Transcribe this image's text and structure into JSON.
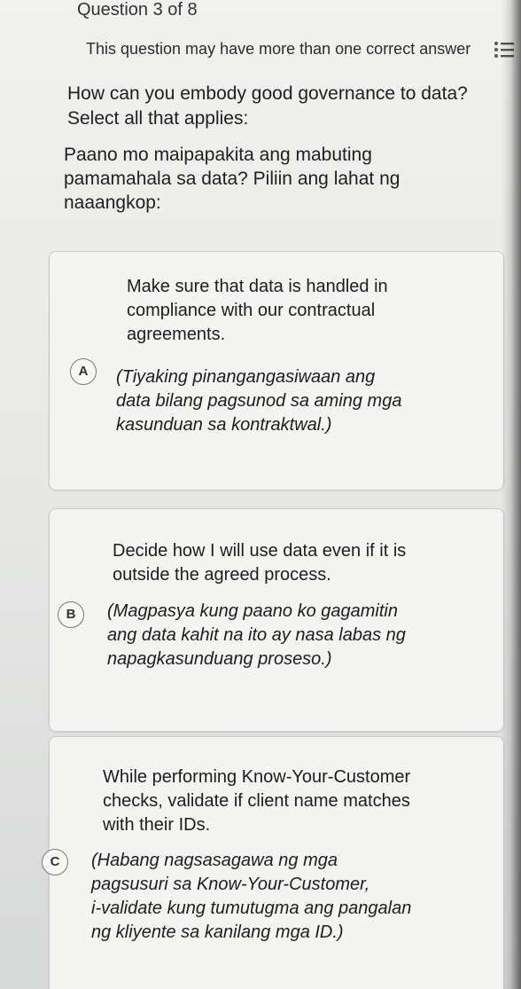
{
  "header": {
    "question_counter": "Question 3 of 8",
    "list_icon": "list-icon"
  },
  "question": {
    "instruction": "This question may have more than one correct answer",
    "title_en": "How can you embody good governance to data?\nSelect all that applies:",
    "title_fil": "Paano mo maipapakita ang mabuting\npamamahala sa data? Piliin ang lahat ng\nnaaangkop:"
  },
  "options": [
    {
      "letter": "A",
      "text_en": "Make sure that data is handled in\ncompliance with our contractual\nagreements.",
      "text_fil": "(Tiyaking pinangangasiwaan ang\ndata bilang pagsunod sa aming mga\nkasunduan sa kontraktwal.)"
    },
    {
      "letter": "B",
      "text_en": "Decide how I will use data even if it is\noutside the agreed process.",
      "text_fil": "(Magpasya kung paano ko gagamitin\nang data kahit na ito ay nasa labas ng\nnapagkasunduang proseso.)"
    },
    {
      "letter": "C",
      "text_en": "While performing Know-Your-Customer\nchecks, validate if client name matches\nwith their IDs.",
      "text_fil": "(Habang nagsasagawa ng mga\npagsusuri sa Know-Your-Customer,\ni-validate kung tumutugma ang pangalan\nng kliyente sa kanilang mga ID.)"
    }
  ]
}
